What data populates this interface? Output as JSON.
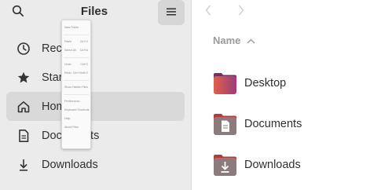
{
  "header": {
    "title": "Files",
    "search_icon": "search-icon",
    "menu_icon": "hamburger-menu-icon"
  },
  "sidebar": {
    "items": [
      {
        "label": "Recent",
        "icon": "clock-icon"
      },
      {
        "label": "Starred",
        "icon": "star-icon"
      },
      {
        "label": "Home",
        "icon": "home-icon",
        "active": true
      },
      {
        "label": "Documents",
        "icon": "document-icon"
      },
      {
        "label": "Downloads",
        "icon": "download-icon"
      }
    ]
  },
  "popover": {
    "rows": [
      {
        "label": "New Folder",
        "shortcut": ""
      },
      {
        "label": "Paste",
        "shortcut": "Ctrl+V"
      },
      {
        "label": "Select All",
        "shortcut": "Ctrl+A"
      },
      {
        "label": "Undo",
        "shortcut": "Ctrl+Z"
      },
      {
        "label": "Redo",
        "shortcut": "Ctrl+Shift+Z"
      },
      {
        "label": "Show Hidden Files",
        "shortcut": ""
      },
      {
        "label": "Preferences",
        "shortcut": ""
      },
      {
        "label": "Keyboard Shortcuts",
        "shortcut": ""
      },
      {
        "label": "Help",
        "shortcut": ""
      },
      {
        "label": "About Files",
        "shortcut": ""
      }
    ]
  },
  "main": {
    "column_header": "Name",
    "sort_icon": "chevron-up-icon",
    "files": [
      {
        "name": "Desktop",
        "icon": "folder-desktop-icon"
      },
      {
        "name": "Documents",
        "icon": "folder-documents-icon"
      },
      {
        "name": "Downloads",
        "icon": "folder-downloads-icon"
      }
    ]
  },
  "colors": {
    "sidebar_bg": "#ebebeb",
    "active_item": "#d9d9d9",
    "folder_desktop_gradient": [
      "#e0614a",
      "#9a3d7e"
    ],
    "folder_body": "#8b7b7b",
    "folder_tab": "#b83a3a"
  }
}
